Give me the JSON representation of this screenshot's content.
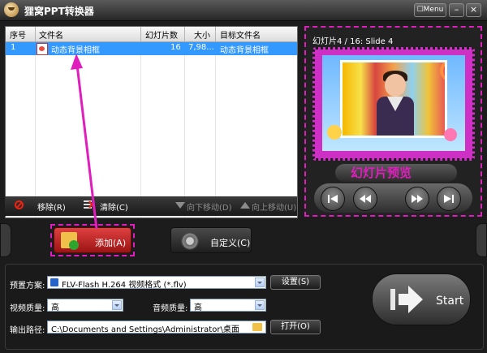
{
  "window": {
    "title": "狸窝PPT转换器",
    "menu_label": "Menu",
    "minimize": "–",
    "close": "×"
  },
  "list": {
    "columns": [
      "序号",
      "文件名",
      "幻灯片数",
      "大小",
      "目标文件名"
    ],
    "rows": [
      {
        "index": "1",
        "filename": "动态背景相框",
        "slides": "16",
        "size": "7,98...",
        "target": "动态背景相框"
      }
    ]
  },
  "list_toolbar": {
    "remove": "移除(R)",
    "clear": "清除(C)",
    "move_down": "向下移动(D)",
    "move_up": "向上移动(U)"
  },
  "preview": {
    "slide_label": "幻灯片4 / 16: Slide 4",
    "caption": "幻灯片预览"
  },
  "actions": {
    "add": "添加(A)",
    "custom": "自定义(C)"
  },
  "settings": {
    "preset_label": "预置方案:",
    "preset_value": "FLV-Flash H.264 视频格式 (*.flv)",
    "settings_button": "设置(S)",
    "video_quality_label": "视频质量:",
    "video_quality_value": "高",
    "audio_quality_label": "音频质量:",
    "audio_quality_value": "高",
    "output_path_label": "输出路径:",
    "output_path_value": "C:\\Documents and Settings\\Administrator\\桌面",
    "open_button": "打开(O)"
  },
  "start": {
    "label": "Start"
  },
  "colors": {
    "highlight": "#e01ebe",
    "selected_row": "#3399ff",
    "add_button": "#c62828"
  }
}
